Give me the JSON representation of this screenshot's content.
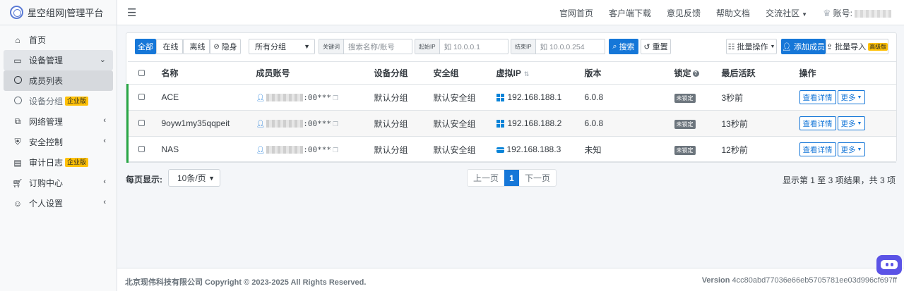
{
  "brand": {
    "title": "星空组网|管理平台"
  },
  "sidebar": {
    "items": [
      {
        "label": "首页",
        "icon": "home-icon"
      },
      {
        "label": "设备管理",
        "icon": "monitor-icon"
      },
      {
        "label": "成员列表",
        "icon": "circle-icon"
      },
      {
        "label": "设备分组",
        "icon": "circle-icon",
        "badge": "企业版"
      },
      {
        "label": "网络管理",
        "icon": "network-icon"
      },
      {
        "label": "安全控制",
        "icon": "shield-icon"
      },
      {
        "label": "审计日志",
        "icon": "document-icon",
        "badge": "企业版"
      },
      {
        "label": "订购中心",
        "icon": "cart-icon"
      },
      {
        "label": "个人设置",
        "icon": "user-gear-icon"
      }
    ]
  },
  "topnav": {
    "links": [
      "官网首页",
      "客户端下载",
      "意见反馈",
      "帮助文档",
      "交流社区"
    ],
    "account_label": "账号:"
  },
  "toolbar": {
    "filter_all": "全部",
    "filter_online": "在线",
    "filter_offline": "离线",
    "filter_hidden": "隐身",
    "group_select": "所有分组",
    "keyword_addon": "关键词",
    "keyword_placeholder": "搜索名称/账号",
    "start_ip_addon": "起始IP",
    "start_ip_placeholder": "如 10.0.0.1",
    "end_ip_addon": "结束IP",
    "end_ip_placeholder": "如 10.0.0.254",
    "search": "搜索",
    "reset": "重置",
    "batch_ops": "批量操作",
    "add_member": "添加成员",
    "batch_import": "批量导入",
    "advanced_badge": "高级版"
  },
  "table": {
    "headers": [
      "名称",
      "成员账号",
      "设备分组",
      "安全组",
      "虚拟IP",
      "版本",
      "锁定",
      "最后活跃",
      "操作"
    ],
    "rows": [
      {
        "name": "ACE",
        "account_suffix": ":00***",
        "group": "默认分组",
        "security_group": "默认安全组",
        "os_icon": "windows-icon",
        "ip": "192.168.188.1",
        "version": "6.0.8",
        "lock": "未锁定",
        "last_active": "3秒前"
      },
      {
        "name": "9oyw1my35qqpeit",
        "account_suffix": ":00***",
        "group": "默认分组",
        "security_group": "默认安全组",
        "os_icon": "windows-icon",
        "ip": "192.168.188.2",
        "version": "6.0.8",
        "lock": "未锁定",
        "last_active": "13秒前"
      },
      {
        "name": "NAS",
        "account_suffix": ":00***",
        "group": "默认分组",
        "security_group": "默认安全组",
        "os_icon": "nas-icon",
        "ip": "192.168.188.3",
        "version": "未知",
        "lock": "未锁定",
        "last_active": "12秒前"
      }
    ],
    "detail_btn": "查看详情",
    "more_btn": "更多"
  },
  "pagination": {
    "per_page_label": "每页显示:",
    "per_page_value": "10条/页",
    "prev": "上一页",
    "current": "1",
    "next": "下一页",
    "result_info": "显示第 1 至 3 项结果，共 3 项"
  },
  "footer": {
    "copyright": "北京现伟科技有限公司 Copyright © 2023-2025 All Rights Reserved.",
    "version_label": "Version",
    "version_hash": "4cc80abd77036e66eb5705781ee03d996cf697ff"
  },
  "colors": {
    "primary": "#1677d8",
    "online": "#28a745",
    "badge": "#ffc107"
  }
}
